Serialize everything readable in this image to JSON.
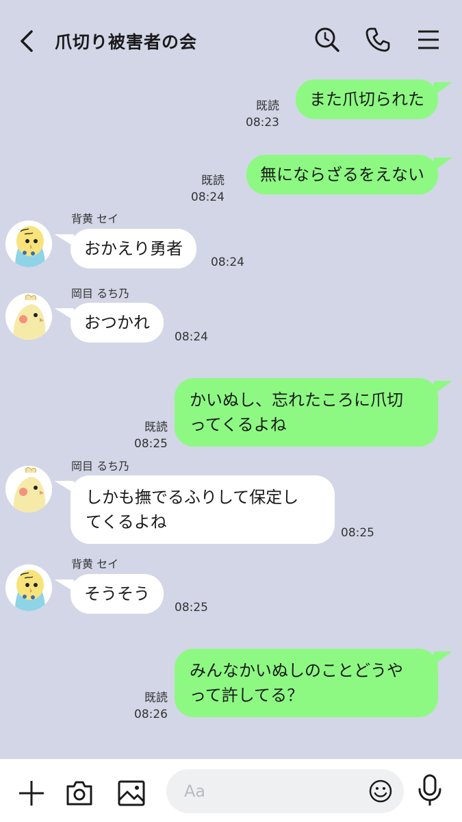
{
  "header": {
    "title": "爪切り被害者の会"
  },
  "messages": [
    {
      "text": "また爪切られた",
      "read": "既読",
      "time": "08:23"
    },
    {
      "text": "無にならざるをえない",
      "read": "既読",
      "time": "08:24"
    },
    {
      "sender": "背黄 セイ",
      "text": "おかえり勇者",
      "time": "08:24"
    },
    {
      "sender": "岡目 るち乃",
      "text": "おつかれ",
      "time": "08:24"
    },
    {
      "line1": "かいぬし、忘れたころに爪切",
      "line2": "ってくるよね",
      "read": "既読",
      "time": "08:25"
    },
    {
      "sender": "岡目 るち乃",
      "line1": "しかも撫でるふりして保定し",
      "line2": "てくるよね",
      "time": "08:25"
    },
    {
      "sender": "背黄 セイ",
      "text": "そうそう",
      "time": "08:25"
    },
    {
      "line1": "みんなかいぬしのことどうや",
      "line2": "って許してる？",
      "read": "既読",
      "time": "08:26"
    }
  ],
  "input": {
    "placeholder": "Aa"
  },
  "colors": {
    "background": "#d2d6e6",
    "outgoing_bubble": "#8df983",
    "incoming_bubble": "#ffffff"
  },
  "icons": [
    "back-chevron-icon",
    "search-icon",
    "phone-icon",
    "menu-icon",
    "plus-icon",
    "camera-icon",
    "image-icon",
    "emoji-icon",
    "mic-icon"
  ]
}
